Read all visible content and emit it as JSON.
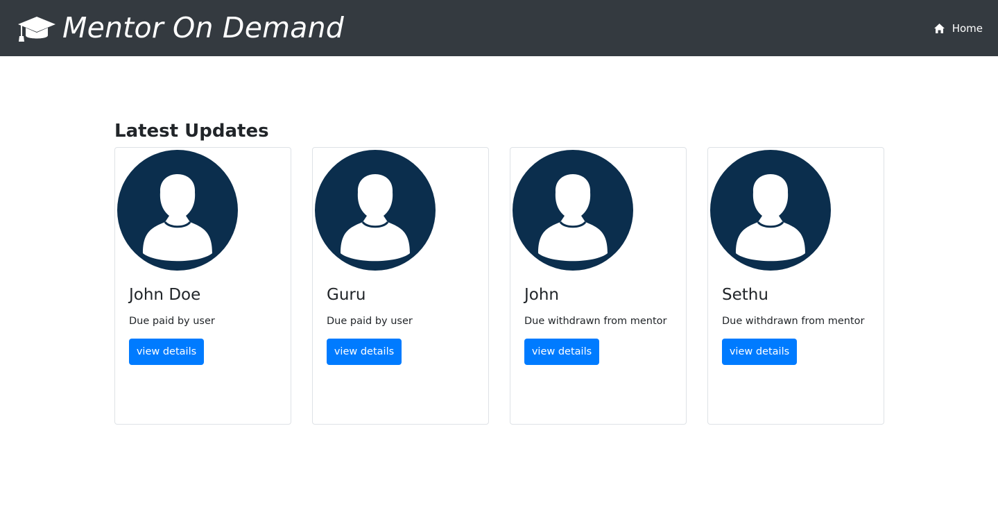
{
  "header": {
    "brand_icon": "graduation-cap-icon",
    "brand_title": "Mentor On Demand",
    "nav": {
      "home_label": "Home",
      "home_icon": "home-icon"
    },
    "colors": {
      "background": "#343a40",
      "text": "#ffffff"
    }
  },
  "main": {
    "section_title": "Latest Updates",
    "cards": [
      {
        "name": "John Doe",
        "description": "Due paid by user",
        "button_label": "view details",
        "avatar_icon": "user-avatar-icon"
      },
      {
        "name": "Guru",
        "description": "Due paid by user",
        "button_label": "view details",
        "avatar_icon": "user-avatar-icon"
      },
      {
        "name": "John",
        "description": "Due withdrawn from mentor",
        "button_label": "view details",
        "avatar_icon": "user-avatar-icon"
      },
      {
        "name": "Sethu",
        "description": "Due withdrawn from mentor",
        "button_label": "view details",
        "avatar_icon": "user-avatar-icon"
      }
    ],
    "colors": {
      "button": "#007bff",
      "avatar": "#0b2e4d"
    }
  }
}
